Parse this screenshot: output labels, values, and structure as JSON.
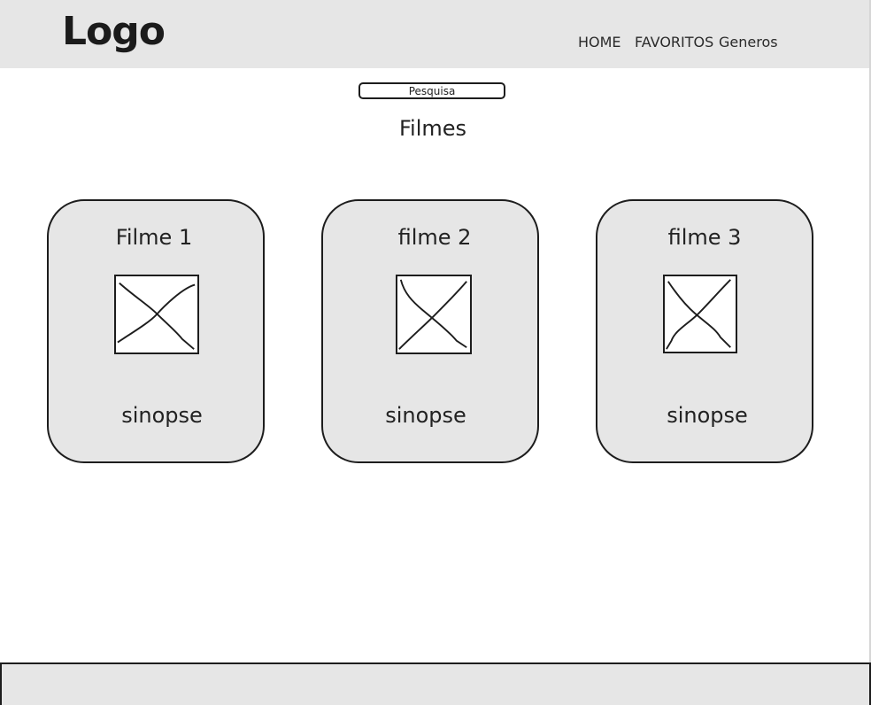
{
  "header": {
    "logo": "Logo",
    "nav": {
      "home": "HOME",
      "favorites": "FAVORITOS",
      "genres": "Generos"
    }
  },
  "search": {
    "placeholder": "Pesquisa"
  },
  "main": {
    "title": "Filmes",
    "cards": [
      {
        "title": "Filme 1",
        "synopsis": "sinopse",
        "image_icon": "image-placeholder-icon"
      },
      {
        "title": "filme 2",
        "synopsis": "sinopse",
        "image_icon": "image-placeholder-icon"
      },
      {
        "title": "filme 3",
        "synopsis": "sinopse",
        "image_icon": "image-placeholder-icon"
      }
    ]
  },
  "colors": {
    "header_bg": "#e6e6e6",
    "card_bg": "#e6e6e6",
    "stroke": "#1d1d1d",
    "page_bg": "#ffffff"
  }
}
